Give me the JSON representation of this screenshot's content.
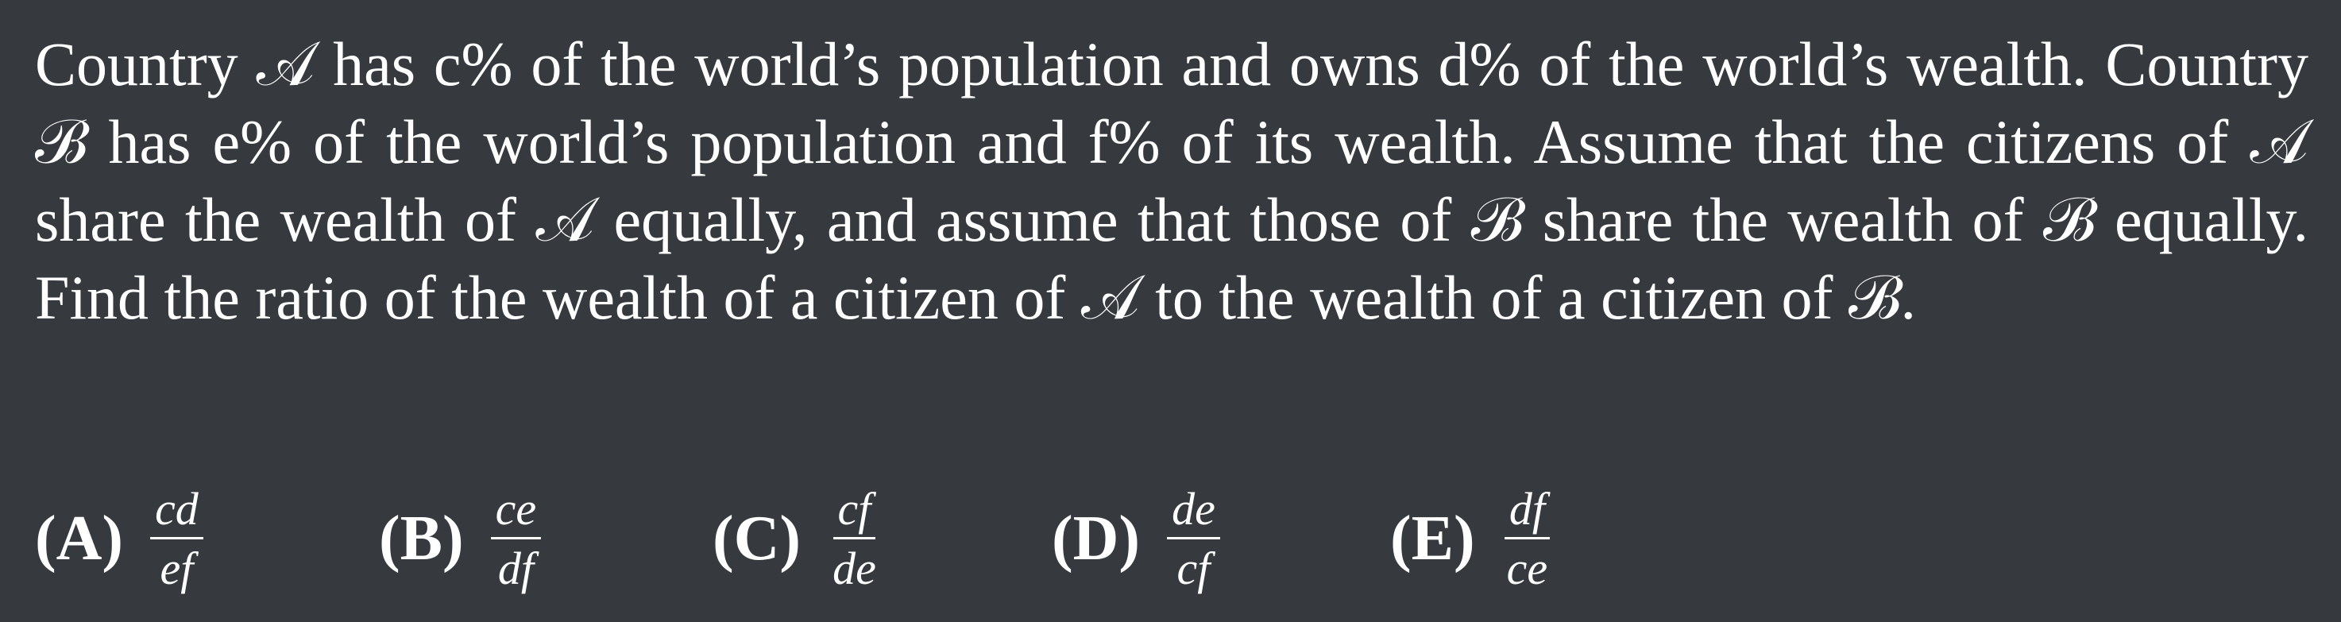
{
  "problem": {
    "text": "Country 𝒜 has c% of the world’s population and owns d% of the world’s wealth. Country ℬ has e% of the world’s population and f% of its wealth. Assume that the citizens of 𝒜 share the wealth of 𝒜 equally, and assume that those of ℬ share the wealth of ℬ equally. Find the ratio of the wealth of a citizen of 𝒜 to the wealth of a citizen of ℬ."
  },
  "choices": [
    {
      "label": "(A)",
      "numerator": "cd",
      "denominator": "ef"
    },
    {
      "label": "(B)",
      "numerator": "ce",
      "denominator": "df"
    },
    {
      "label": "(C)",
      "numerator": "cf",
      "denominator": "de"
    },
    {
      "label": "(D)",
      "numerator": "de",
      "denominator": "cf"
    },
    {
      "label": "(E)",
      "numerator": "df",
      "denominator": "ce"
    }
  ]
}
